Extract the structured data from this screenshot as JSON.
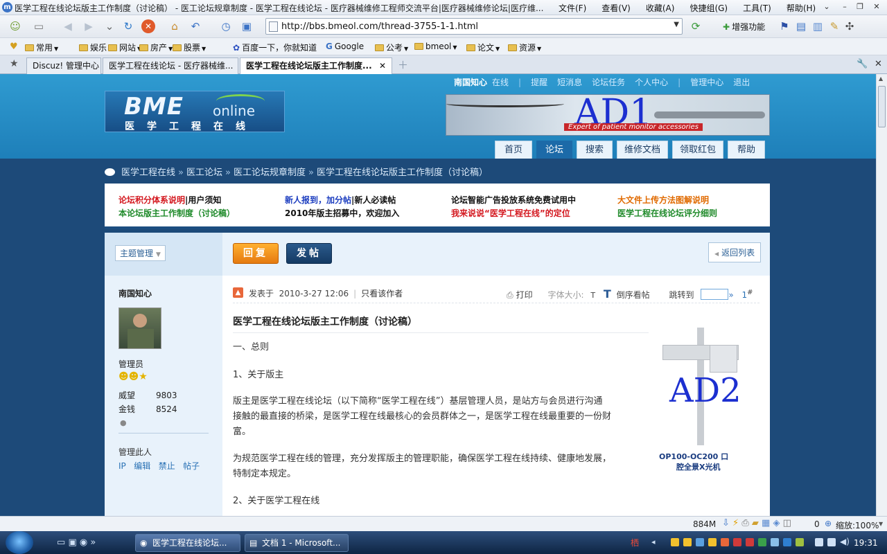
{
  "window": {
    "title": "医学工程在线论坛版主工作制度（讨论稿） - 医工论坛规章制度 - 医学工程在线论坛 - 医疗器械维修工程师交流平台|医疗器械维修论坛|医疗维...",
    "menus": [
      "文件(F)",
      "查看(V)",
      "收藏(A)",
      "快捷组(G)",
      "工具(T)",
      "帮助(H)"
    ]
  },
  "address_bar": {
    "url": "http://bbs.bmeol.com/thread-3755-1-1.html"
  },
  "toolbar": {
    "enhance_label": "增强功能"
  },
  "favorites": [
    {
      "label": "常用",
      "menu": true
    },
    {
      "label": "娱乐",
      "menu": true
    },
    {
      "label": "网站",
      "menu": true
    },
    {
      "label": "房产",
      "menu": true
    },
    {
      "label": "股票",
      "menu": true
    },
    {
      "label": "百度一下，你就知道",
      "menu": false
    },
    {
      "label": "Google",
      "menu": false
    },
    {
      "label": "公考",
      "menu": true
    },
    {
      "label": "bmeol",
      "menu": true
    },
    {
      "label": "论文",
      "menu": true
    },
    {
      "label": "资源",
      "menu": true
    }
  ],
  "tabs": [
    {
      "label": "Discuz! 管理中心",
      "active": false
    },
    {
      "label": "医学工程在线论坛 - 医疗器械维...",
      "active": false
    },
    {
      "label": "医学工程在线论坛版主工作制度...",
      "active": true
    }
  ],
  "site": {
    "logo": {
      "brand": "BME",
      "online": "online",
      "cn": "医学工程在线"
    },
    "ad1": {
      "text": "AD1",
      "subtext": "Expert of patient monitor accessories"
    },
    "top_links": {
      "user": "南国知心",
      "status": "在线",
      "items": [
        "提醒",
        "短消息",
        "论坛任务",
        "个人中心",
        "管理中心",
        "退出"
      ]
    },
    "main_nav": [
      {
        "label": "首页",
        "active": false
      },
      {
        "label": "论坛",
        "active": true
      },
      {
        "label": "搜索",
        "active": false
      },
      {
        "label": "维修文档",
        "active": false
      },
      {
        "label": "领取红包",
        "active": false
      },
      {
        "label": "帮助",
        "active": false
      }
    ],
    "breadcrumb": [
      "医学工程在线",
      "医工论坛",
      "医工论坛规章制度",
      "医学工程在线论坛版主工作制度（讨论稿）"
    ],
    "notices": [
      {
        "parts": [
          {
            "t": "论坛积分体系说明",
            "c": "#d4181f"
          },
          {
            "t": "|用户须知",
            "c": "#111"
          }
        ]
      },
      {
        "parts": [
          {
            "t": "本论坛版主工作制度（讨论稿）",
            "c": "#1f8a2a"
          }
        ]
      },
      {
        "parts": [
          {
            "t": "新人报到，加分帖",
            "c": "#1e3fc0"
          },
          {
            "t": "|新人必读帖",
            "c": "#111"
          }
        ]
      },
      {
        "parts": [
          {
            "t": "2010年版主招募中，欢迎加入",
            "c": "#111"
          }
        ]
      },
      {
        "parts": [
          {
            "t": "论坛智能广告投放系统免费试用中",
            "c": "#111"
          }
        ]
      },
      {
        "parts": [
          {
            "t": "我来说说“医学工程在线”的定位",
            "c": "#d4181f"
          }
        ]
      },
      {
        "parts": [
          {
            "t": "大文件上传方法图解说明",
            "c": "#e06a00"
          }
        ]
      },
      {
        "parts": [
          {
            "t": "医学工程在线论坛评分细则",
            "c": "#1f8a2a"
          }
        ]
      }
    ]
  },
  "post": {
    "manage_label": "主题管理",
    "reply_label": "回复",
    "new_post_label": "发帖",
    "back_label": "返回列表",
    "author": {
      "name": "南国知心",
      "role": "管理员",
      "stats": [
        {
          "k": "威望",
          "v": "9803"
        },
        {
          "k": "金钱",
          "v": "8524"
        }
      ],
      "manage_title": "管理此人",
      "manage_links": [
        "IP",
        "编辑",
        "禁止",
        "帖子"
      ]
    },
    "meta": {
      "posted_prefix": "发表于",
      "posted_at": "2010-3-27 12:06",
      "only_author": "只看该作者",
      "print": "打印",
      "font_size": "字体大小:",
      "font_t": "T",
      "font_T": "T",
      "reverse": "倒序看帖",
      "jump": "跳转到",
      "floor": "1",
      "hash": "#"
    },
    "title": "医学工程在线论坛版主工作制度（讨论稿）",
    "body": [
      "一、总则",
      "1、关于版主",
      "版主是医学工程在线论坛（以下简称“医学工程在线”）基层管理人员，是站方与会员进行沟通",
      "接触的最直接的桥梁，是医学工程在线最核心的会员群体之一，是医学工程在线最重要的一份财",
      "富。",
      "为规范医学工程在线的管理，充分发挥版主的管理职能，确保医学工程在线持续、健康地发展，",
      "特制定本规定。",
      "2、关于医学工程在线"
    ],
    "ad2": {
      "text": "AD2",
      "caption1": "OP100-OC200 口",
      "caption2": "腔全景X光机"
    }
  },
  "statusbar": {
    "memory": "884M",
    "count": "0",
    "zoom": "缩放:100%"
  },
  "taskbar": {
    "tasks": [
      "医学工程在线论坛...",
      "文档 1 - Microsoft..."
    ],
    "clock": "19:31"
  }
}
